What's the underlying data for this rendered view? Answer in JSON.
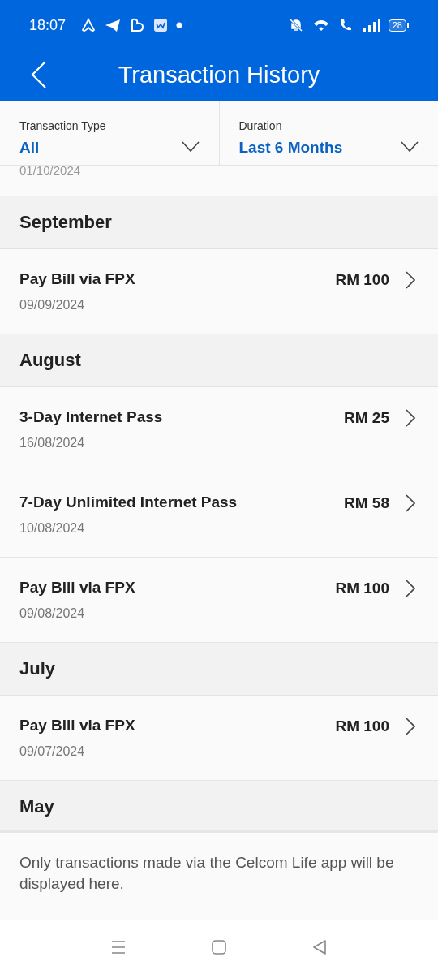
{
  "status_bar": {
    "time": "18:07",
    "battery": "28"
  },
  "header": {
    "title": "Transaction History"
  },
  "filters": [
    {
      "label": "Transaction Type",
      "value": "All"
    },
    {
      "label": "Duration",
      "value": "Last 6 Months"
    }
  ],
  "cut_off_transaction": {
    "date": "01/10/2024"
  },
  "sections": [
    {
      "month": "September",
      "transactions": [
        {
          "title": "Pay Bill via FPX",
          "date": "09/09/2024",
          "amount": "RM 100"
        }
      ]
    },
    {
      "month": "August",
      "transactions": [
        {
          "title": "3-Day Internet Pass",
          "date": "16/08/2024",
          "amount": "RM 25"
        },
        {
          "title": "7-Day Unlimited Internet Pass",
          "date": "10/08/2024",
          "amount": "RM 58"
        },
        {
          "title": "Pay Bill via FPX",
          "date": "09/08/2024",
          "amount": "RM 100"
        }
      ]
    },
    {
      "month": "July",
      "transactions": [
        {
          "title": "Pay Bill via FPX",
          "date": "09/07/2024",
          "amount": "RM 100"
        }
      ]
    },
    {
      "month": "May"
    }
  ],
  "note": "Only transactions made via the Celcom Life app will be displayed here."
}
